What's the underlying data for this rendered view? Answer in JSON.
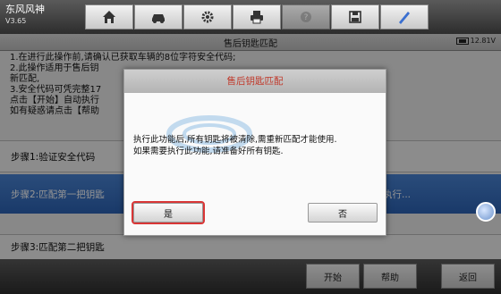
{
  "app": {
    "brand": "东风风神",
    "version": "V3.65"
  },
  "toolbar": {
    "buttons": [
      {
        "name": "home-icon"
      },
      {
        "name": "car-icon"
      },
      {
        "name": "gear-icon"
      },
      {
        "name": "printer-icon"
      },
      {
        "name": "help-icon",
        "disabled": true
      },
      {
        "name": "save-icon"
      },
      {
        "name": "pen-icon"
      }
    ]
  },
  "titlebar": {
    "title": "售后钥匙匹配",
    "battery": "12.81V"
  },
  "info": {
    "lines": [
      "1.在进行此操作前,请确认已获取车辆的8位字符安全代码;",
      "2.此操作适用于售后钥",
      "新匹配,",
      "3.安全代码可凭完整17",
      "点击【开始】自动执行",
      "如有疑惑请点击【帮助"
    ]
  },
  "steps": {
    "step1": "步骤1:验证安全代码",
    "step2": "步骤2:匹配第一把钥匙",
    "step2_right": "执行...",
    "step3": "步骤3:匹配第二把钥匙"
  },
  "bottom": {
    "start": "开始",
    "help": "帮助",
    "back": "返回"
  },
  "dialog": {
    "title": "售后钥匙匹配",
    "line1": "执行此功能后,所有钥匙将被清除,需重新匹配才能使用.",
    "line2": "如果需要执行此功能,请准备好所有钥匙.",
    "yes": "是",
    "no": "否"
  },
  "colors": {
    "accent_blue": "#2c63b5",
    "dialog_title_red": "#c0392b",
    "highlight_red": "#d93636"
  }
}
